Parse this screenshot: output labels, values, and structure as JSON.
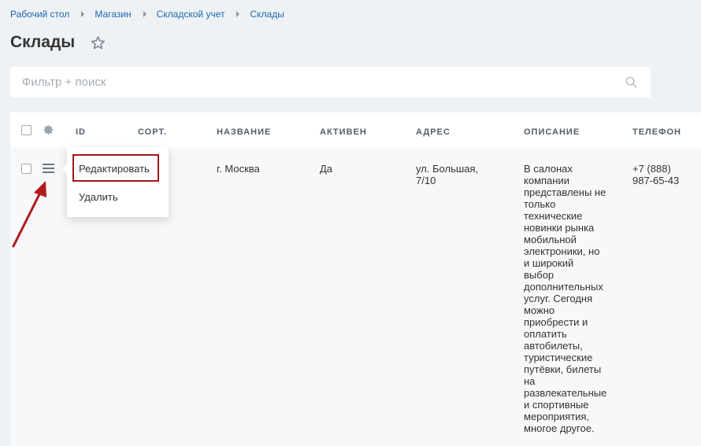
{
  "breadcrumb": [
    "Рабочий стол",
    "Магазин",
    "Складской учет",
    "Склады"
  ],
  "page_title": "Склады",
  "filter": {
    "placeholder": "Фильтр + поиск",
    "value": ""
  },
  "columns": {
    "id": "ID",
    "sort": "СОРТ.",
    "name": "НАЗВАНИЕ",
    "active": "АКТИВЕН",
    "address": "АДРЕС",
    "description": "ОПИСАНИЕ",
    "phone": "ТЕЛЕФОН"
  },
  "row": {
    "name": "г. Москва",
    "active": "Да",
    "address_lines": [
      "ул. Большая,",
      "7/10"
    ],
    "description_lines": [
      "В салонах",
      "компании",
      "представлены не",
      "только",
      "технические",
      "новинки рынка",
      "мобильной",
      "электроники, но",
      "и широкий",
      "выбор",
      "дополнительных",
      "услуг. Сегодня",
      "можно",
      "приобрести и",
      "оплатить",
      "автобилеты,",
      "туристические",
      "путёвки, билеты",
      "на",
      "развлекательные",
      "и спортивные",
      "мероприятия,",
      "многое другое."
    ],
    "phone_lines": [
      "+7 (888)",
      "987-65-43"
    ]
  },
  "context_menu": {
    "edit": "Редактировать",
    "delete": "Удалить"
  },
  "colors": {
    "link": "#2067b0",
    "highlight": "#a3151d",
    "background": "#eef2f4"
  }
}
